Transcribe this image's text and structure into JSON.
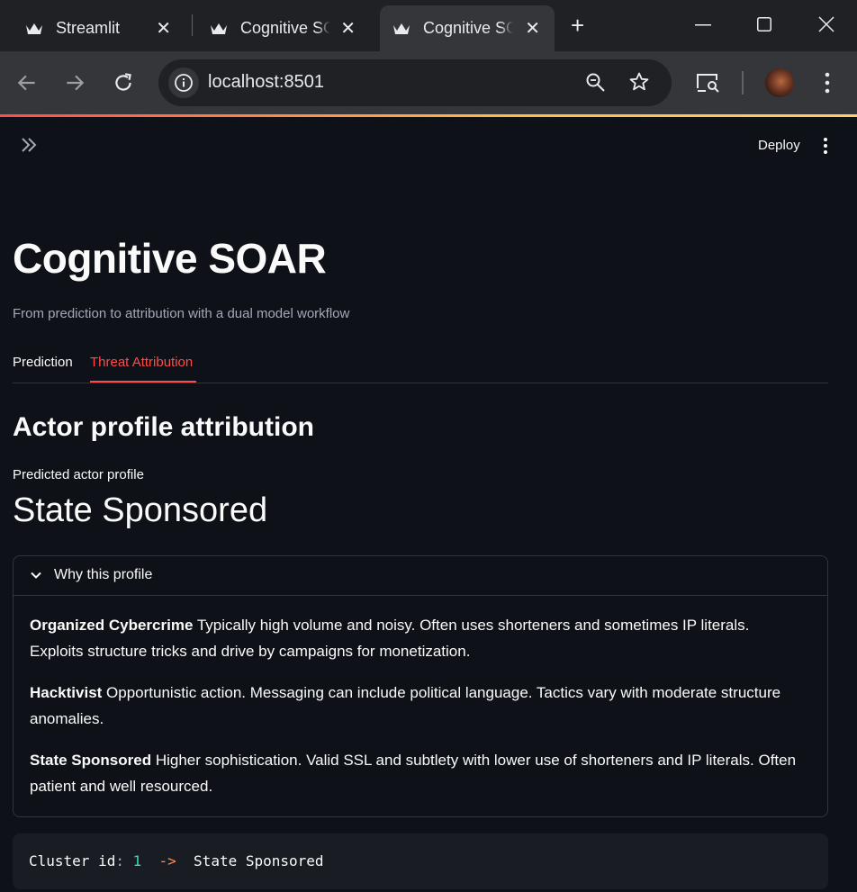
{
  "browser": {
    "tabs": [
      {
        "title": "Streamlit",
        "active": false
      },
      {
        "title": "Cognitive SOAR",
        "active": false
      },
      {
        "title": "Cognitive SOAR",
        "active": true
      }
    ],
    "url": "localhost:8501"
  },
  "app": {
    "deploy_label": "Deploy",
    "title": "Cognitive SOAR",
    "caption": "From prediction to attribution with a dual model workflow",
    "tabs": [
      {
        "label": "Prediction",
        "active": false
      },
      {
        "label": "Threat Attribution",
        "active": true
      }
    ],
    "section_heading": "Actor profile attribution",
    "metric": {
      "label": "Predicted actor profile",
      "value": "State Sponsored"
    },
    "expander": {
      "title": "Why this profile",
      "items": [
        {
          "name": "Organized Cybercrime",
          "text": " Typically high volume and noisy. Often uses shorteners and sometimes IP literals. Exploits structure tricks and drive by campaigns for monetization."
        },
        {
          "name": "Hacktivist",
          "text": " Opportunistic action. Messaging can include political language. Tactics vary with moderate structure anomalies."
        },
        {
          "name": "State Sponsored",
          "text": " Higher sophistication. Valid SSL and subtlety with lower use of shorteners and IP literals. Often patient and well resourced."
        }
      ]
    },
    "code": {
      "key": "Cluster id",
      "colon": ":",
      "id": "1",
      "arrow": "->",
      "result": "State Sponsored"
    }
  },
  "colors": {
    "accent": "#ff4b4b",
    "background": "#0e1117"
  }
}
